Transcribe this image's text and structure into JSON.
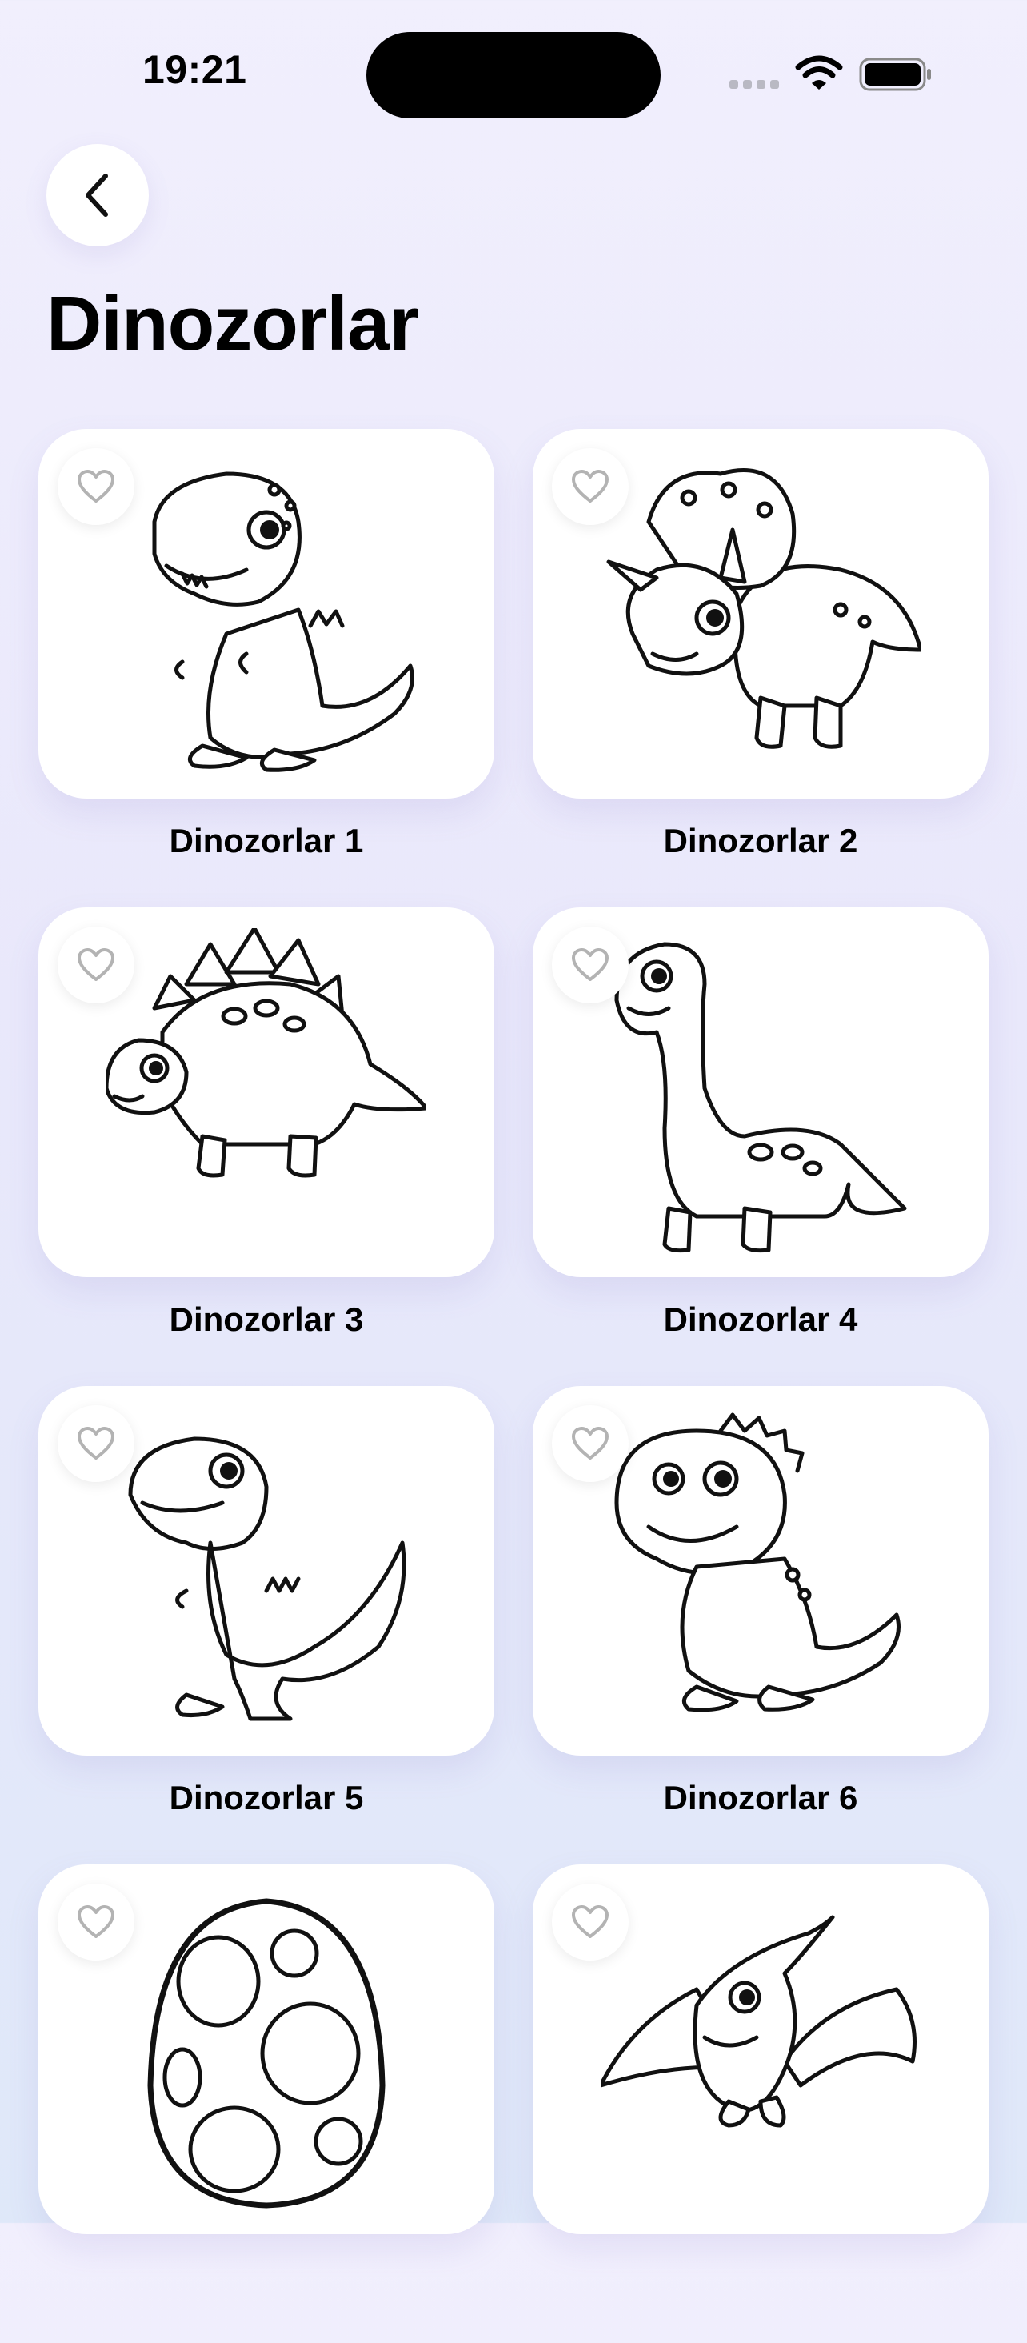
{
  "status_bar": {
    "time": "19:21"
  },
  "header": {
    "back_icon": "chevron-left-icon",
    "title": "Dinozorlar"
  },
  "items": [
    {
      "label": "Dinozorlar 1",
      "art": "t-rex"
    },
    {
      "label": "Dinozorlar 2",
      "art": "triceratops"
    },
    {
      "label": "Dinozorlar 3",
      "art": "stegosaurus"
    },
    {
      "label": "Dinozorlar 4",
      "art": "brachiosaurus"
    },
    {
      "label": "Dinozorlar 5",
      "art": "raptor"
    },
    {
      "label": "Dinozorlar 6",
      "art": "baby-dinosaur"
    },
    {
      "label": "",
      "art": "dinosaur-egg"
    },
    {
      "label": "",
      "art": "pterodactyl"
    }
  ],
  "favorite_icon": "heart-outline-icon",
  "colors": {
    "background_top": "#f1effd",
    "background_bottom": "#dfe8f9",
    "card": "#ffffff",
    "heart": "#b3b3b3",
    "text": "#000000"
  }
}
